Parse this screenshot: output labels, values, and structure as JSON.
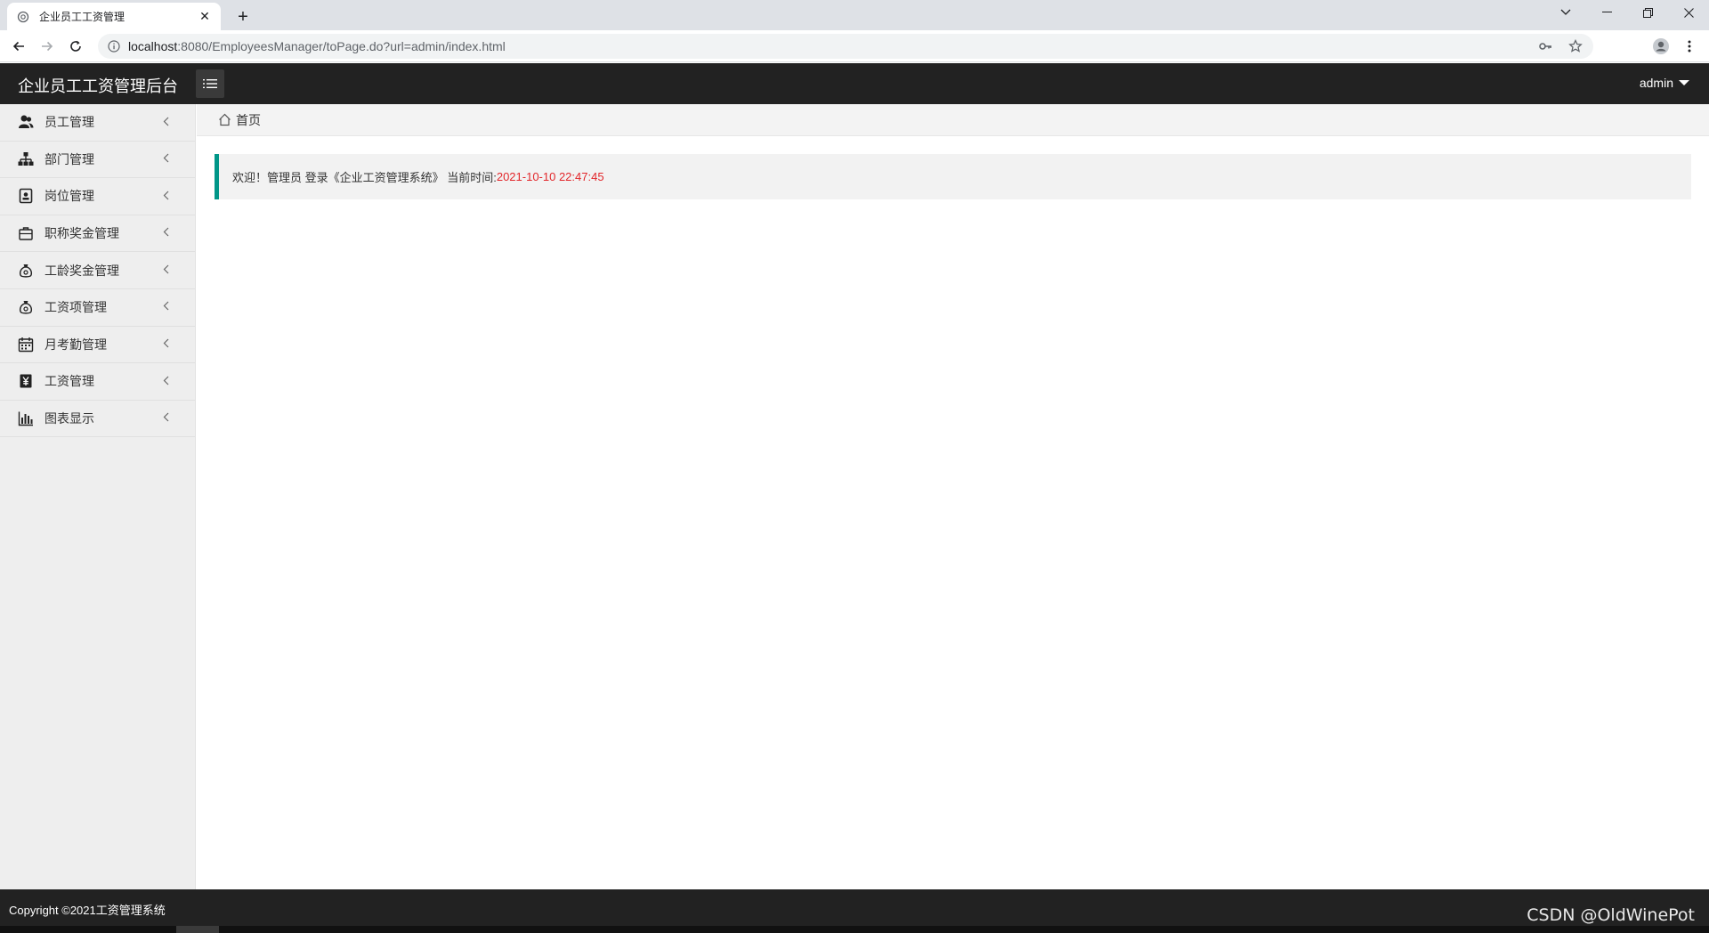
{
  "browser": {
    "tab_title": "企业员工工资管理",
    "url_host": "localhost",
    "url_rest": ":8080/EmployeesManager/toPage.do?url=admin/index.html"
  },
  "header": {
    "title": "企业员工工资管理后台",
    "user": "admin"
  },
  "sidebar": {
    "items": [
      {
        "label": "员工管理",
        "icon": "user-group-icon"
      },
      {
        "label": "部门管理",
        "icon": "org-chart-icon"
      },
      {
        "label": "岗位管理",
        "icon": "badge-icon"
      },
      {
        "label": "职称奖金管理",
        "icon": "briefcase-icon"
      },
      {
        "label": "工龄奖金管理",
        "icon": "money-bag-icon"
      },
      {
        "label": "工资项管理",
        "icon": "money-bag-icon"
      },
      {
        "label": "月考勤管理",
        "icon": "calendar-icon"
      },
      {
        "label": "工资管理",
        "icon": "yen-icon"
      },
      {
        "label": "图表显示",
        "icon": "bar-chart-icon"
      }
    ]
  },
  "breadcrumb": {
    "home": "首页"
  },
  "welcome": {
    "text": "欢迎！管理员 登录《企业工资管理系统》 当前时间:",
    "time": "2021-10-10 22:47:45"
  },
  "footer": {
    "copyright": "Copyright ©2021工资管理系统",
    "watermark": "CSDN @OldWinePot"
  },
  "colors": {
    "accent": "#009688",
    "time": "#e2262a",
    "header_bg": "#222222"
  }
}
